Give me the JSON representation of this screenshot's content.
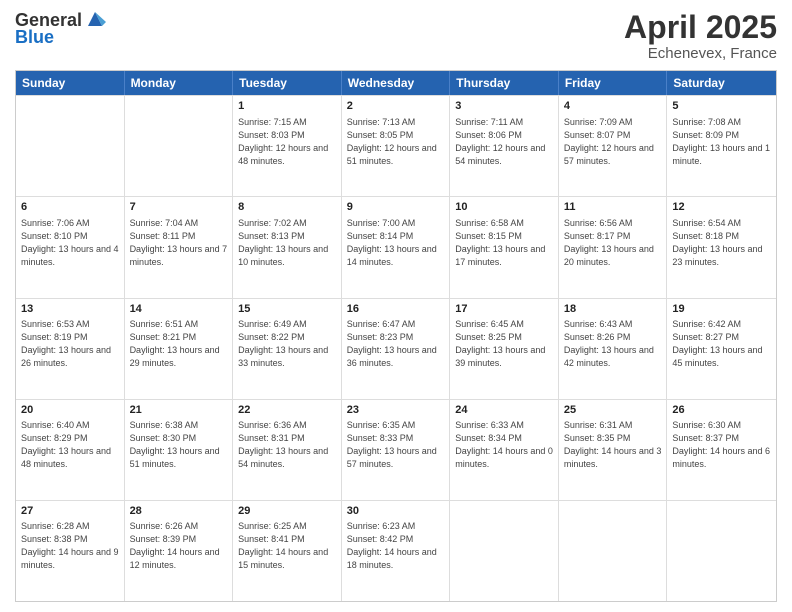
{
  "header": {
    "logo_general": "General",
    "logo_blue": "Blue",
    "title": "April 2025",
    "subtitle": "Echenevex, France"
  },
  "calendar": {
    "days": [
      "Sunday",
      "Monday",
      "Tuesday",
      "Wednesday",
      "Thursday",
      "Friday",
      "Saturday"
    ],
    "rows": [
      [
        {
          "day": "",
          "info": ""
        },
        {
          "day": "",
          "info": ""
        },
        {
          "day": "1",
          "info": "Sunrise: 7:15 AM\nSunset: 8:03 PM\nDaylight: 12 hours and 48 minutes."
        },
        {
          "day": "2",
          "info": "Sunrise: 7:13 AM\nSunset: 8:05 PM\nDaylight: 12 hours and 51 minutes."
        },
        {
          "day": "3",
          "info": "Sunrise: 7:11 AM\nSunset: 8:06 PM\nDaylight: 12 hours and 54 minutes."
        },
        {
          "day": "4",
          "info": "Sunrise: 7:09 AM\nSunset: 8:07 PM\nDaylight: 12 hours and 57 minutes."
        },
        {
          "day": "5",
          "info": "Sunrise: 7:08 AM\nSunset: 8:09 PM\nDaylight: 13 hours and 1 minute."
        }
      ],
      [
        {
          "day": "6",
          "info": "Sunrise: 7:06 AM\nSunset: 8:10 PM\nDaylight: 13 hours and 4 minutes."
        },
        {
          "day": "7",
          "info": "Sunrise: 7:04 AM\nSunset: 8:11 PM\nDaylight: 13 hours and 7 minutes."
        },
        {
          "day": "8",
          "info": "Sunrise: 7:02 AM\nSunset: 8:13 PM\nDaylight: 13 hours and 10 minutes."
        },
        {
          "day": "9",
          "info": "Sunrise: 7:00 AM\nSunset: 8:14 PM\nDaylight: 13 hours and 14 minutes."
        },
        {
          "day": "10",
          "info": "Sunrise: 6:58 AM\nSunset: 8:15 PM\nDaylight: 13 hours and 17 minutes."
        },
        {
          "day": "11",
          "info": "Sunrise: 6:56 AM\nSunset: 8:17 PM\nDaylight: 13 hours and 20 minutes."
        },
        {
          "day": "12",
          "info": "Sunrise: 6:54 AM\nSunset: 8:18 PM\nDaylight: 13 hours and 23 minutes."
        }
      ],
      [
        {
          "day": "13",
          "info": "Sunrise: 6:53 AM\nSunset: 8:19 PM\nDaylight: 13 hours and 26 minutes."
        },
        {
          "day": "14",
          "info": "Sunrise: 6:51 AM\nSunset: 8:21 PM\nDaylight: 13 hours and 29 minutes."
        },
        {
          "day": "15",
          "info": "Sunrise: 6:49 AM\nSunset: 8:22 PM\nDaylight: 13 hours and 33 minutes."
        },
        {
          "day": "16",
          "info": "Sunrise: 6:47 AM\nSunset: 8:23 PM\nDaylight: 13 hours and 36 minutes."
        },
        {
          "day": "17",
          "info": "Sunrise: 6:45 AM\nSunset: 8:25 PM\nDaylight: 13 hours and 39 minutes."
        },
        {
          "day": "18",
          "info": "Sunrise: 6:43 AM\nSunset: 8:26 PM\nDaylight: 13 hours and 42 minutes."
        },
        {
          "day": "19",
          "info": "Sunrise: 6:42 AM\nSunset: 8:27 PM\nDaylight: 13 hours and 45 minutes."
        }
      ],
      [
        {
          "day": "20",
          "info": "Sunrise: 6:40 AM\nSunset: 8:29 PM\nDaylight: 13 hours and 48 minutes."
        },
        {
          "day": "21",
          "info": "Sunrise: 6:38 AM\nSunset: 8:30 PM\nDaylight: 13 hours and 51 minutes."
        },
        {
          "day": "22",
          "info": "Sunrise: 6:36 AM\nSunset: 8:31 PM\nDaylight: 13 hours and 54 minutes."
        },
        {
          "day": "23",
          "info": "Sunrise: 6:35 AM\nSunset: 8:33 PM\nDaylight: 13 hours and 57 minutes."
        },
        {
          "day": "24",
          "info": "Sunrise: 6:33 AM\nSunset: 8:34 PM\nDaylight: 14 hours and 0 minutes."
        },
        {
          "day": "25",
          "info": "Sunrise: 6:31 AM\nSunset: 8:35 PM\nDaylight: 14 hours and 3 minutes."
        },
        {
          "day": "26",
          "info": "Sunrise: 6:30 AM\nSunset: 8:37 PM\nDaylight: 14 hours and 6 minutes."
        }
      ],
      [
        {
          "day": "27",
          "info": "Sunrise: 6:28 AM\nSunset: 8:38 PM\nDaylight: 14 hours and 9 minutes."
        },
        {
          "day": "28",
          "info": "Sunrise: 6:26 AM\nSunset: 8:39 PM\nDaylight: 14 hours and 12 minutes."
        },
        {
          "day": "29",
          "info": "Sunrise: 6:25 AM\nSunset: 8:41 PM\nDaylight: 14 hours and 15 minutes."
        },
        {
          "day": "30",
          "info": "Sunrise: 6:23 AM\nSunset: 8:42 PM\nDaylight: 14 hours and 18 minutes."
        },
        {
          "day": "",
          "info": ""
        },
        {
          "day": "",
          "info": ""
        },
        {
          "day": "",
          "info": ""
        }
      ]
    ]
  }
}
